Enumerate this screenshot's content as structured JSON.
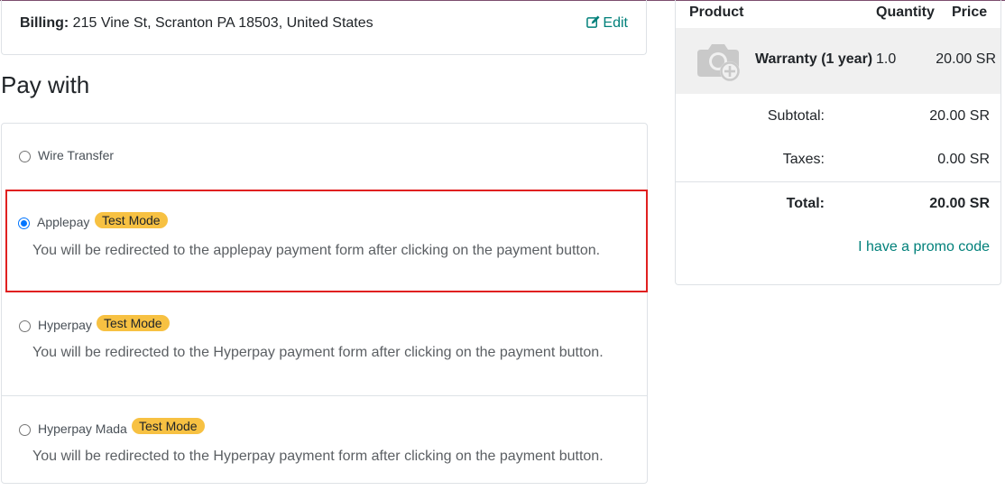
{
  "billing": {
    "label": "Billing:",
    "address": "215 Vine St, Scranton PA 18503, United States",
    "edit_label": "Edit"
  },
  "pay_with": {
    "heading": "Pay with",
    "options": [
      {
        "label": "Wire Transfer",
        "selected": false
      },
      {
        "label": "Applepay",
        "selected": true,
        "badge": "Test Mode",
        "description": "You will be redirected to the applepay payment form after clicking on the payment button."
      },
      {
        "label": "Hyperpay",
        "selected": false,
        "badge": "Test Mode",
        "description": "You will be redirected to the Hyperpay payment form after clicking on the payment button."
      },
      {
        "label": "Hyperpay Mada",
        "selected": false,
        "badge": "Test Mode",
        "description": "You will be redirected to the Hyperpay payment form after clicking on the payment button."
      }
    ]
  },
  "order_summary": {
    "headers": {
      "product": "Product",
      "quantity": "Quantity",
      "price": "Price"
    },
    "line": {
      "name": "Warranty (1 year)",
      "quantity": "1.0",
      "price": "20.00 SR",
      "image_icon": "camera-plus-icon"
    },
    "subtotal": {
      "label": "Subtotal:",
      "value": "20.00 SR"
    },
    "taxes": {
      "label": "Taxes:",
      "value": "0.00 SR"
    },
    "total": {
      "label": "Total:",
      "value": "20.00 SR"
    },
    "promo_label": "I have a promo code"
  },
  "colors": {
    "accent": "#01807a",
    "badge": "#f7c142",
    "highlight_border": "#e02020",
    "radio_selected": "#0075ff"
  }
}
